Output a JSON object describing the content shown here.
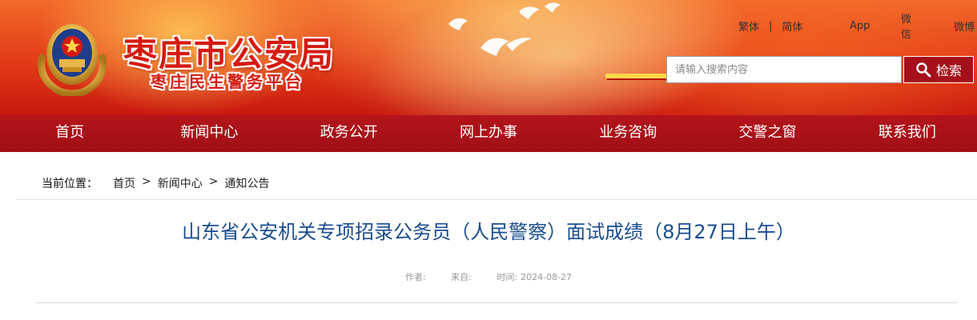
{
  "header": {
    "site_title": "枣庄市公安局",
    "site_subtitle": "枣庄民生警务平台",
    "top_links": {
      "traditional": "繁体",
      "separator": "|",
      "simplified": "简体",
      "app": "App",
      "wechat": "微信",
      "weibo": "微博"
    },
    "search": {
      "placeholder": "请输入搜索内容",
      "button_label": "检索"
    }
  },
  "nav": {
    "items": [
      {
        "label": "首页"
      },
      {
        "label": "新闻中心"
      },
      {
        "label": "政务公开"
      },
      {
        "label": "网上办事"
      },
      {
        "label": "业务咨询"
      },
      {
        "label": "交警之窗"
      },
      {
        "label": "联系我们"
      }
    ]
  },
  "breadcrumb": {
    "label": "当前位置：",
    "items": [
      "首页",
      "新闻中心",
      "通知公告"
    ],
    "separator": ">"
  },
  "article": {
    "title": "山东省公安机关专项招录公务员（人民警察）面试成绩（8月27日上午）",
    "meta": {
      "author_label": "作者:",
      "source_label": "来自:",
      "time_label": "时间:",
      "time_value": "2024-08-27"
    }
  },
  "colors": {
    "banner_red": "#e23a17",
    "nav_red": "#a10f16",
    "title_blue": "#1a4d8f",
    "hotline_yellow": "#ffd84a"
  }
}
